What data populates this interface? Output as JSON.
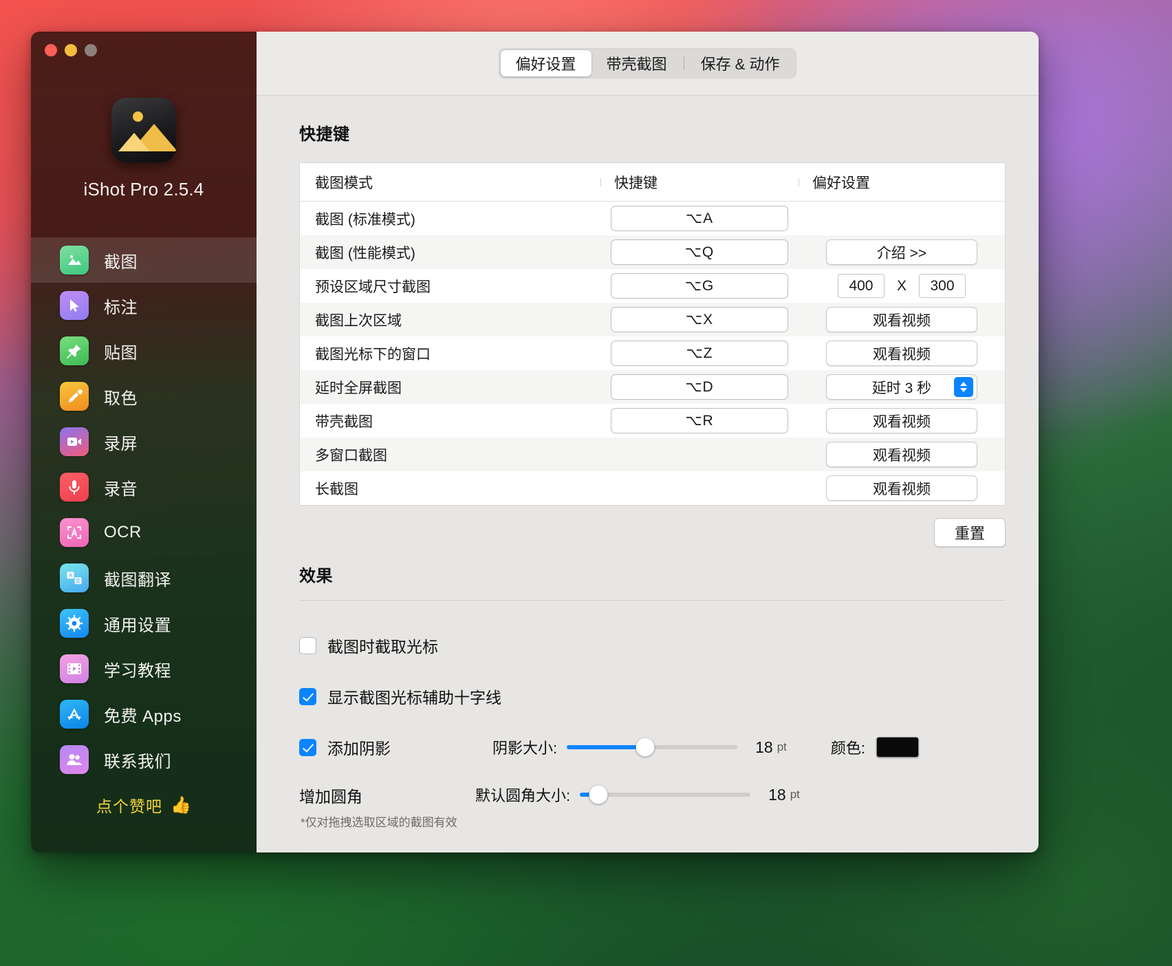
{
  "window": {
    "traffic_lights": [
      "close",
      "minimize",
      "zoom"
    ]
  },
  "sidebar": {
    "app_name": "iShot Pro 2.5.4",
    "app_icon": "photo-mountain-icon",
    "items": [
      {
        "label": "截图",
        "icon": "screenshot-icon",
        "active": true
      },
      {
        "label": "标注",
        "icon": "annotate-icon",
        "active": false
      },
      {
        "label": "贴图",
        "icon": "pin-icon",
        "active": false
      },
      {
        "label": "取色",
        "icon": "eyedropper-icon",
        "active": false
      },
      {
        "label": "录屏",
        "icon": "screenrecord-icon",
        "active": false
      },
      {
        "label": "录音",
        "icon": "microphone-icon",
        "active": false
      },
      {
        "label": "OCR",
        "icon": "ocr-icon",
        "active": false
      },
      {
        "label": "截图翻译",
        "icon": "translate-icon",
        "active": false
      },
      {
        "label": "通用设置",
        "icon": "gear-icon",
        "active": false
      },
      {
        "label": "学习教程",
        "icon": "tutorial-icon",
        "active": false
      },
      {
        "label": "免费 Apps",
        "icon": "appstore-icon",
        "active": false
      },
      {
        "label": "联系我们",
        "icon": "contacts-icon",
        "active": false
      }
    ],
    "like": {
      "text": "点个赞吧",
      "emoji": "👍"
    }
  },
  "tabs": [
    {
      "label": "偏好设置",
      "active": true
    },
    {
      "label": "带壳截图",
      "active": false
    },
    {
      "label": "保存 & 动作",
      "active": false
    }
  ],
  "shortcuts": {
    "title": "快捷键",
    "columns": [
      "截图模式",
      "快捷键",
      "偏好设置"
    ],
    "rows": [
      {
        "mode": "截图 (标准模式)",
        "key": "⌥A",
        "pref_type": "none"
      },
      {
        "mode": "截图 (性能模式)",
        "key": "⌥Q",
        "pref_type": "button",
        "pref_label": "介绍  >>"
      },
      {
        "mode": "预设区域尺寸截图",
        "key": "⌥G",
        "pref_type": "size",
        "width": "400",
        "x_label": "X",
        "height": "300"
      },
      {
        "mode": "截图上次区域",
        "key": "⌥X",
        "pref_type": "button",
        "pref_label": "观看视频"
      },
      {
        "mode": "截图光标下的窗口",
        "key": "⌥Z",
        "pref_type": "button",
        "pref_label": "观看视频"
      },
      {
        "mode": "延时全屏截图",
        "key": "⌥D",
        "pref_type": "popup",
        "pref_label": "延时 3 秒"
      },
      {
        "mode": "带壳截图",
        "key": "⌥R",
        "pref_type": "button",
        "pref_label": "观看视频"
      },
      {
        "mode": "多窗口截图",
        "key": "",
        "pref_type": "button",
        "pref_label": "观看视频"
      },
      {
        "mode": "长截图",
        "key": "",
        "pref_type": "button",
        "pref_label": "观看视频"
      }
    ],
    "reset_label": "重置"
  },
  "effects": {
    "title": "效果",
    "capture_cursor": {
      "label": "截图时截取光标",
      "checked": false
    },
    "show_crosshair": {
      "label": "显示截图光标辅助十字线",
      "checked": true
    },
    "add_shadow": {
      "label": "添加阴影",
      "checked": true,
      "slider_label": "阴影大小:",
      "value": "18",
      "unit": "pt",
      "percent": 46,
      "color_label": "颜色:",
      "color_value": "#0a0a0a"
    },
    "corner_radius": {
      "label": "增加圆角",
      "slider_label": "默认圆角大小:",
      "value": "18",
      "unit": "pt",
      "percent": 11,
      "note": "*仅对拖拽选取区域的截图有效"
    }
  },
  "colors": {
    "accent": "#0a84ff",
    "sidebar_like": "#f2d33c",
    "panel_bg": "#e7e6e4"
  }
}
